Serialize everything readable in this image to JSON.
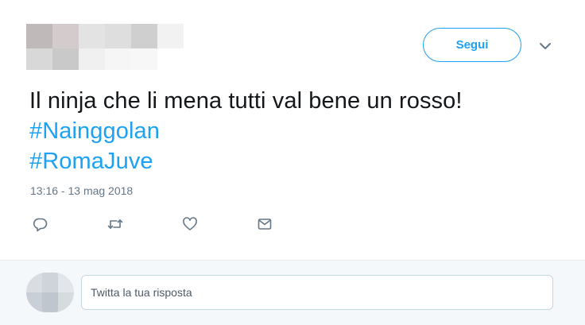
{
  "header": {
    "follow_label": "Segui",
    "more_icon": "chevron-down-icon"
  },
  "tweet": {
    "text": "Il ninja che li mena tutti val bene un rosso!",
    "hashtags": [
      "#Nainggolan",
      "#RomaJuve"
    ],
    "timestamp": "13:16 - 13 mag 2018"
  },
  "actions": [
    {
      "icon": "reply-icon"
    },
    {
      "icon": "retweet-icon"
    },
    {
      "icon": "like-icon"
    },
    {
      "icon": "message-icon"
    }
  ],
  "reply": {
    "placeholder": "Twitta la tua risposta"
  },
  "colors": {
    "accent": "#1da1f2",
    "text": "#14171a",
    "muted": "#657786",
    "reply_background": "#f5f8fa"
  }
}
